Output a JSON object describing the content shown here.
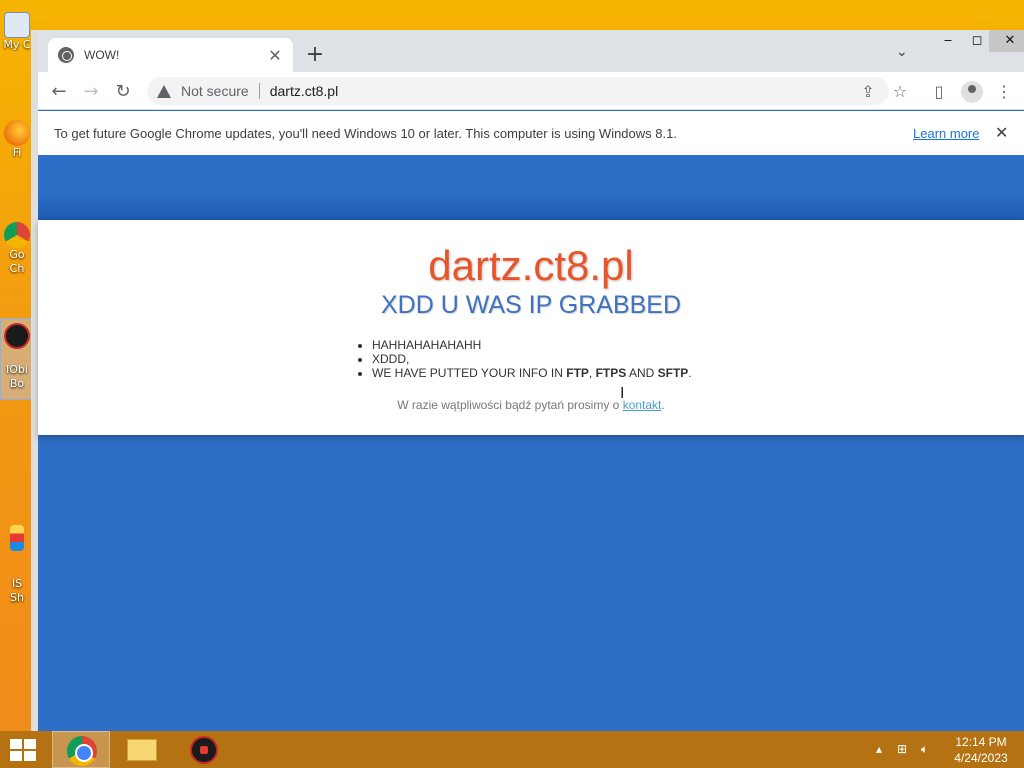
{
  "desktop": {
    "icons": [
      {
        "label": "My C",
        "name": "my-computer"
      },
      {
        "label": "Fi",
        "name": "firefox"
      },
      {
        "label": "Go\nCh",
        "name": "google-chrome"
      },
      {
        "label": "IObi\nBo",
        "name": "iobit-booster"
      },
      {
        "label": "IS\nSh",
        "name": "is-shortcut"
      }
    ]
  },
  "browser": {
    "tab": {
      "title": "WOW!"
    },
    "address": {
      "security_label": "Not secure",
      "url": "dartz.ct8.pl"
    },
    "infobar": {
      "message": "To get future Google Chrome updates, you'll need Windows 10 or later. This computer is using Windows 8.1.",
      "link": "Learn more"
    }
  },
  "page": {
    "site_title": "dartz.ct8.pl",
    "headline": "XDD U WAS IP GRABBED",
    "bullets": {
      "b1": "HAHHAHAHAHAHH",
      "b2": "XDDD,",
      "b3_prefix": "WE HAVE PUTTED YOUR INFO IN ",
      "b3_ftp": "FTP",
      "b3_comma": ", ",
      "b3_ftps": "FTPS",
      "b3_and": " AND ",
      "b3_sftp": "SFTP",
      "b3_end": "."
    },
    "contact_text": "W razie wątpliwości bądź pytań prosimy o ",
    "contact_link": "kontakt",
    "contact_end": "."
  },
  "taskbar": {
    "time": "12:14 PM",
    "date": "4/24/2023"
  },
  "colors": {
    "page_background": "#2d6fc7",
    "site_title": "#e8552a",
    "headline": "#3f72c0"
  }
}
